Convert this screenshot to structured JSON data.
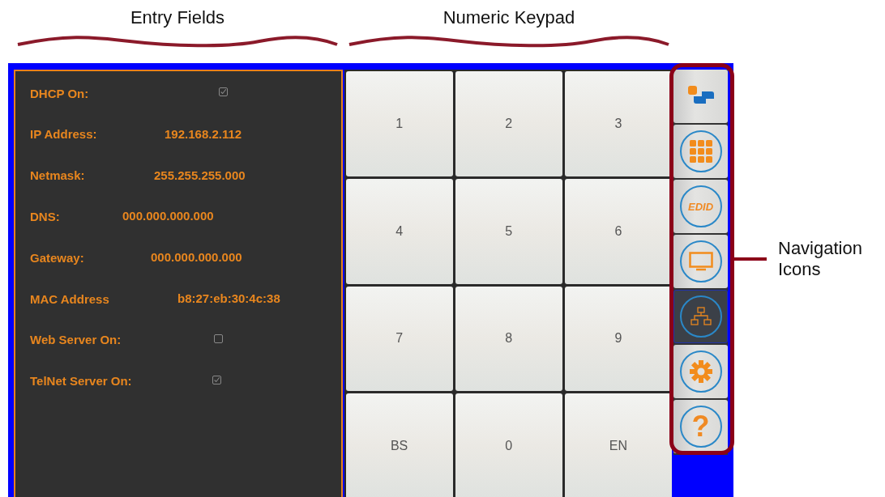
{
  "annotations": {
    "entry_fields": "Entry Fields",
    "numeric_keypad": "Numeric Keypad",
    "navigation": "Navigation Icons"
  },
  "fields": [
    {
      "kind": "checkbox",
      "label": "DHCP On:",
      "checked": true
    },
    {
      "kind": "text",
      "label": "IP Address:",
      "value": "192.168.2.112"
    },
    {
      "kind": "text",
      "label": "Netmask:",
      "value": "255.255.255.000"
    },
    {
      "kind": "text",
      "label": "DNS:",
      "value": "000.000.000.000"
    },
    {
      "kind": "text",
      "label": "Gateway:",
      "value": "000.000.000.000"
    },
    {
      "kind": "text",
      "label": "MAC Address",
      "value": "b8:27:eb:30:4c:38"
    },
    {
      "kind": "checkbox",
      "label": "Web Server On:",
      "checked": false
    },
    {
      "kind": "checkbox",
      "label": "TelNet Server On:",
      "checked": true
    }
  ],
  "keypad": [
    "1",
    "2",
    "3",
    "4",
    "5",
    "6",
    "7",
    "8",
    "9",
    "BS",
    "0",
    "EN"
  ],
  "nav": [
    {
      "kind": "logo",
      "selected": false
    },
    {
      "kind": "grid",
      "selected": false
    },
    {
      "kind": "edid",
      "label": "EDID",
      "selected": false
    },
    {
      "kind": "monitor",
      "selected": false
    },
    {
      "kind": "network",
      "selected": true
    },
    {
      "kind": "gear",
      "selected": false
    },
    {
      "kind": "help",
      "label": "?",
      "selected": false
    }
  ]
}
